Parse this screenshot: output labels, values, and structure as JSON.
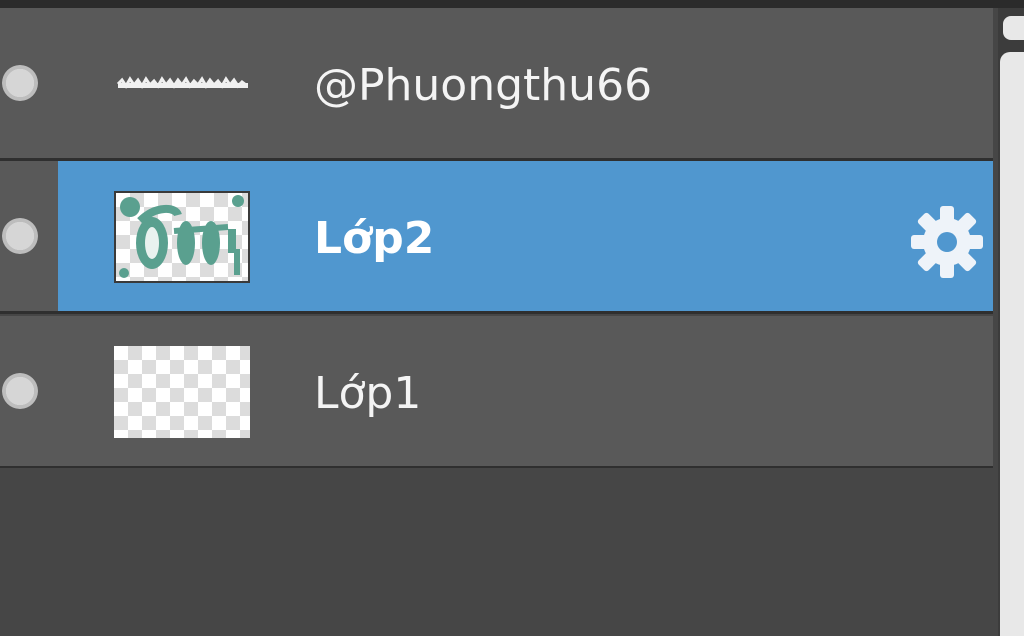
{
  "layers": [
    {
      "name": "@Phuongthu66",
      "selected": false,
      "thumbnail": "text-scribble"
    },
    {
      "name": "Lớp2",
      "selected": true,
      "thumbnail": "teal-drawing"
    },
    {
      "name": "Lớp1",
      "selected": false,
      "thumbnail": "transparent"
    }
  ],
  "icons": {
    "visibility": "visibility-dot-icon",
    "settings": "gear-icon"
  },
  "colors": {
    "row_background": "#595959",
    "selected_background": "#5097cf",
    "panel_background": "#464646",
    "text": "#f4f4f4",
    "thumbnail_ink": "#5aa08f"
  }
}
